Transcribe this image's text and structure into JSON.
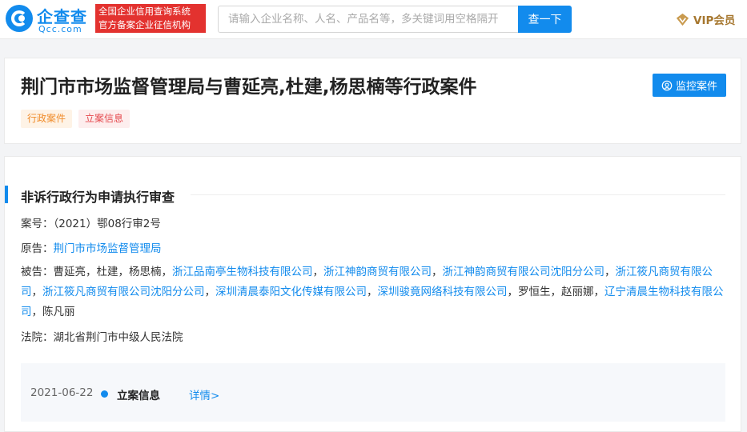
{
  "header": {
    "logo_cn": "企查查",
    "logo_en": "Qcc.com",
    "slogan_line1": "全国企业信用查询系统",
    "slogan_line2": "官方备案企业征信机构",
    "search_placeholder": "请输入企业名称、人名、产品名等，多关键词用空格隔开",
    "search_button": "查一下",
    "vip_label": "VIP会员"
  },
  "case": {
    "title": "荆门市市场监督管理局与曹延亮,杜建,杨思楠等行政案件",
    "tags": [
      "行政案件",
      "立案信息"
    ],
    "monitor_button": "监控案件"
  },
  "detail": {
    "section_title": "非诉行政行为申请执行审查",
    "case_no_label": "案号：",
    "case_no": "（2021）鄂08行审2号",
    "plaintiff_label": "原告：",
    "plaintiff": "荆门市市场监督管理局",
    "defendant_label": "被告：",
    "defendants": [
      {
        "text": "曹延亮",
        "link": false
      },
      {
        "text": "杜建",
        "link": false
      },
      {
        "text": "杨思楠",
        "link": false
      },
      {
        "text": "浙江品南亭生物科技有限公司",
        "link": true
      },
      {
        "text": "浙江神韵商贸有限公司",
        "link": true
      },
      {
        "text": "浙江神韵商贸有限公司沈阳分公司",
        "link": true
      },
      {
        "text": "浙江筱凡商贸有限公司",
        "link": true
      },
      {
        "text": "浙江筱凡商贸有限公司沈阳分公司",
        "link": true
      },
      {
        "text": "深圳清晨泰阳文化传媒有限公司",
        "link": true
      },
      {
        "text": "深圳骏竟网络科技有限公司",
        "link": true
      },
      {
        "text": "罗恒生",
        "link": false
      },
      {
        "text": "赵丽娜",
        "link": false
      },
      {
        "text": "辽宁清晨生物科技有限公司",
        "link": true
      },
      {
        "text": "陈凡丽",
        "link": false
      }
    ],
    "separator": "，",
    "court_label": "法院：",
    "court": "湖北省荆门市中级人民法院"
  },
  "timeline": {
    "date": "2021-06-22",
    "label": "立案信息",
    "link": "详情>"
  },
  "colors": {
    "brand_blue": "#128bed",
    "brand_red": "#e3322f",
    "vip_gold": "#a6772f"
  }
}
